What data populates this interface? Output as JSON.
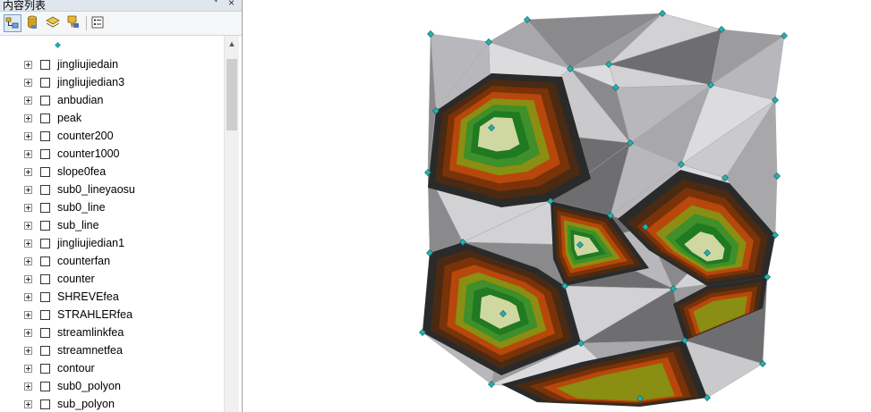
{
  "toc": {
    "title": "内容列表",
    "pin_glyph": "ᐩ",
    "close_glyph": "×",
    "toolbar": [
      {
        "name": "list-by-drawing-order",
        "icon": "list-drawing-order-icon",
        "active": true
      },
      {
        "name": "list-by-source",
        "icon": "database-icon",
        "active": false
      },
      {
        "name": "list-by-visibility",
        "icon": "layers-icon",
        "active": false
      },
      {
        "name": "list-by-selection",
        "icon": "selection-icon",
        "active": false
      },
      {
        "name": "options",
        "icon": "options-list-icon",
        "active": false
      }
    ],
    "layers": [
      {
        "label": "jingliujiedain"
      },
      {
        "label": "jingliujiedian3"
      },
      {
        "label": "anbudian"
      },
      {
        "label": "peak"
      },
      {
        "label": "counter200"
      },
      {
        "label": "counter1000"
      },
      {
        "label": "slope0fea"
      },
      {
        "label": "sub0_lineyaosu"
      },
      {
        "label": "sub0_line"
      },
      {
        "label": "sub_line"
      },
      {
        "label": "jingliujiedian1"
      },
      {
        "label": "counterfan"
      },
      {
        "label": "counter"
      },
      {
        "label": "SHREVEfea"
      },
      {
        "label": "STRAHLERfea"
      },
      {
        "label": "streamlinkfea"
      },
      {
        "label": "streamnetfea"
      },
      {
        "label": "contour"
      },
      {
        "label": "sub0_polyon"
      },
      {
        "label": "sub_polyon"
      }
    ]
  },
  "map": {
    "point_color": "#21b2b2",
    "palette": [
      "#2a2a2a",
      "#4a2a12",
      "#7a3208",
      "#b8470b",
      "#8a8e12",
      "#3f8f2a",
      "#1f7a22",
      "#cfd8a0"
    ],
    "gray_fills": [
      "#b8b8bc",
      "#cacacd",
      "#9c9c9f",
      "#dcdcdf",
      "#8a8a8c",
      "#6e6e70",
      "#a8a8ab",
      "#d2d2d5"
    ]
  }
}
